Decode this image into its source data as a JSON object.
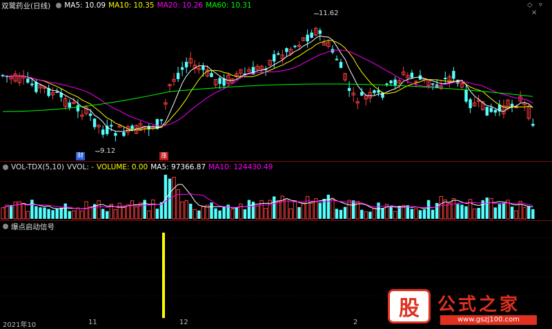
{
  "main_header": {
    "stock": "双鹭药业(日线)",
    "ma5": "MA5: 10.09",
    "ma10": "MA10: 10.35",
    "ma20": "MA20: 10.26",
    "ma60": "MA60: 10.31"
  },
  "annotations": {
    "high_label": "11.62",
    "low_label": "9.12",
    "tag_cai": "财",
    "tag_zhang": "涨"
  },
  "vol_header": {
    "name": "VOL-TDX(5,10)",
    "vvol": "VVOL: -",
    "volume": "VOLUME: 0.00",
    "ma5": "MA5: 97366.87",
    "ma10": "MA10: 124430.49"
  },
  "ind_header": {
    "name": "爆点启动信号"
  },
  "axis_labels": [
    "2021年10",
    "11",
    "12",
    "2"
  ],
  "watermark": {
    "brand": "公式之家",
    "url": "www.gszj100.com",
    "badge": "股"
  },
  "colors": {
    "up": "#ff4040",
    "down": "#54ffff",
    "ma5": "#ffffff",
    "ma10": "#ffff00",
    "ma20": "#ff00ff",
    "ma60": "#00ff00",
    "signal": "#ffff00"
  },
  "chart_data": {
    "type": "candlestick",
    "price_high": 11.62,
    "price_low": 9.12,
    "candles_note": "",
    "signal_index": 0
  }
}
